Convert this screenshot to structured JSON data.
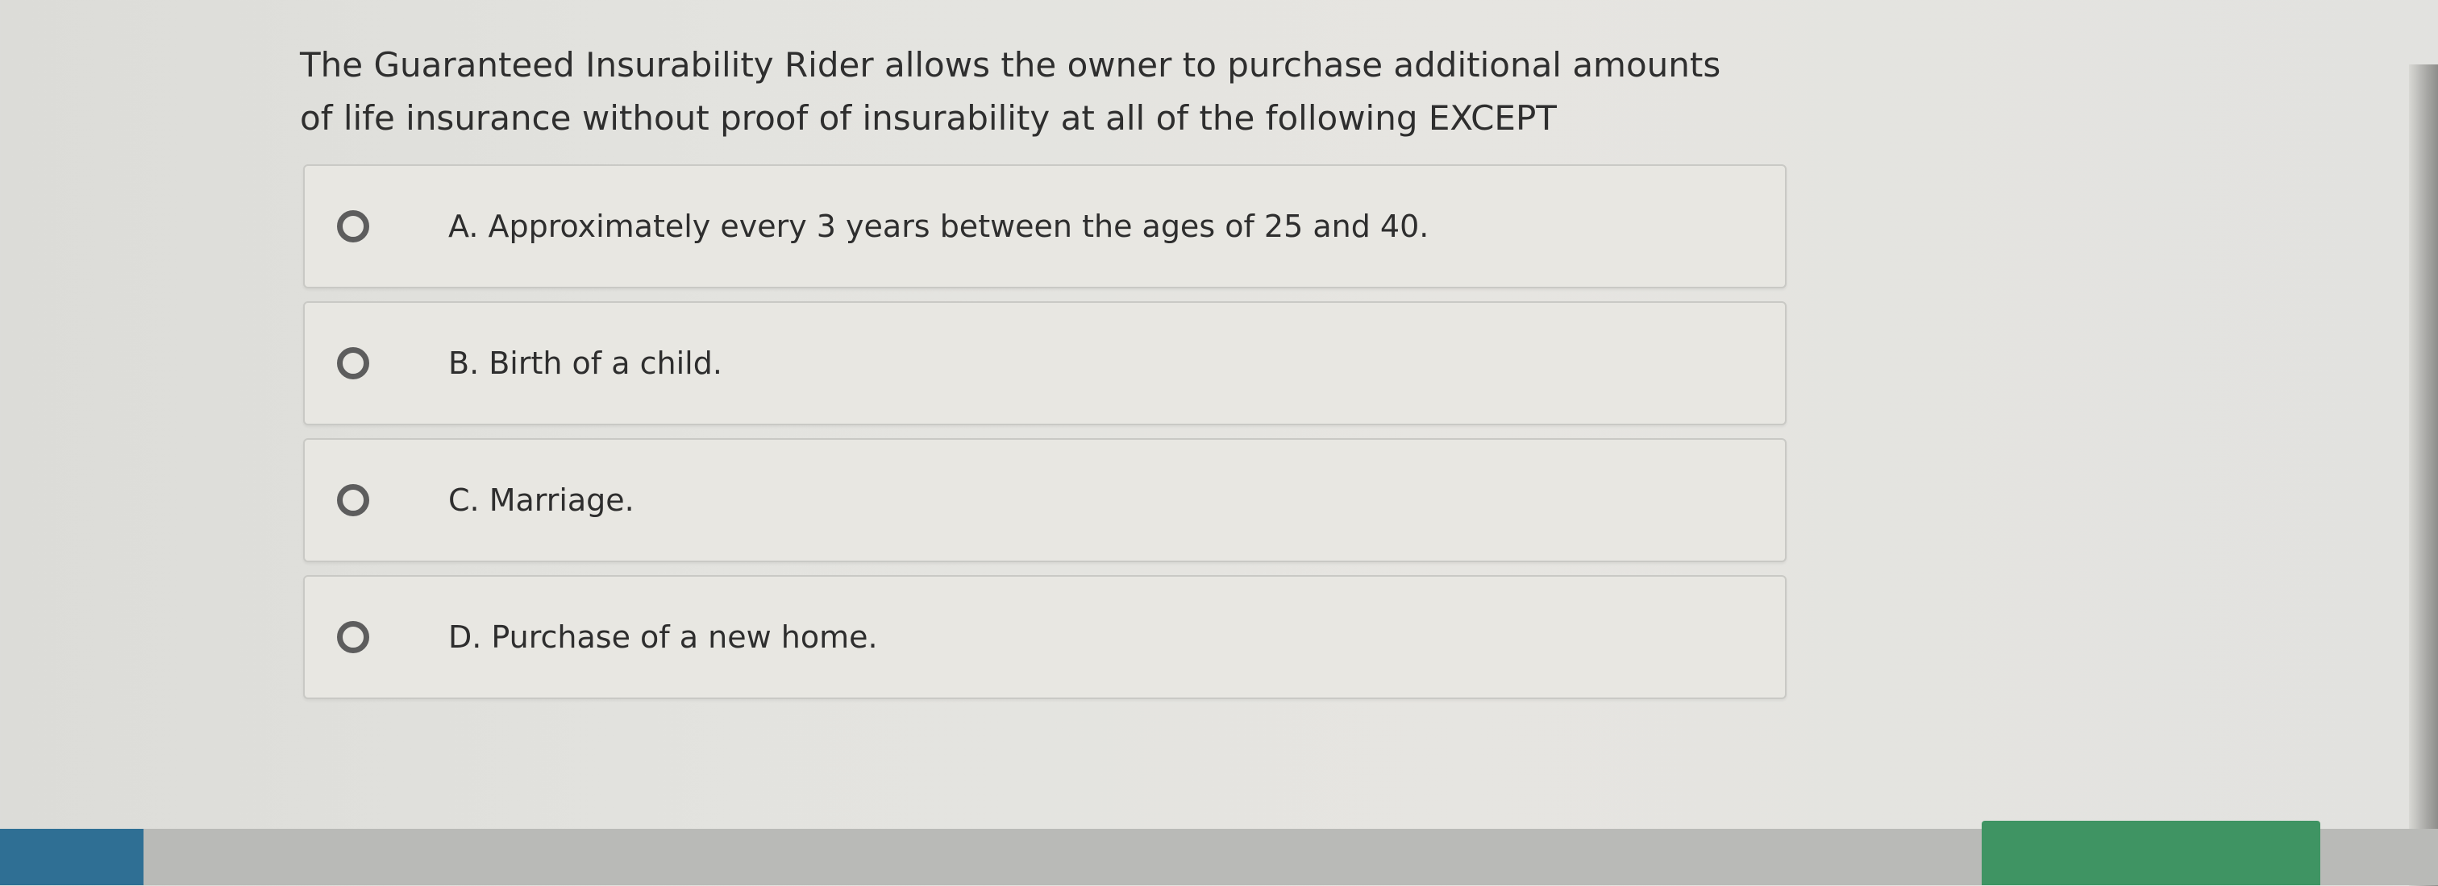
{
  "question": {
    "line1": "The Guaranteed Insurability Rider allows the owner to purchase additional amounts",
    "line2": "of life insurance without proof of insurability at all of the following EXCEPT"
  },
  "options": [
    {
      "label": "A. Approximately every 3 years between the ages of 25 and 40."
    },
    {
      "label": "B. Birth of a child."
    },
    {
      "label": "C. Marriage."
    },
    {
      "label": "D. Purchase of a new home."
    }
  ],
  "colors": {
    "background": "#e3e3df",
    "option_background": "#e8e7e2",
    "option_border": "#c9c9c5",
    "radio_border": "#5d5d5d",
    "bottom_left_accent": "#2f6f94",
    "bottom_right_accent": "#3f9463"
  }
}
